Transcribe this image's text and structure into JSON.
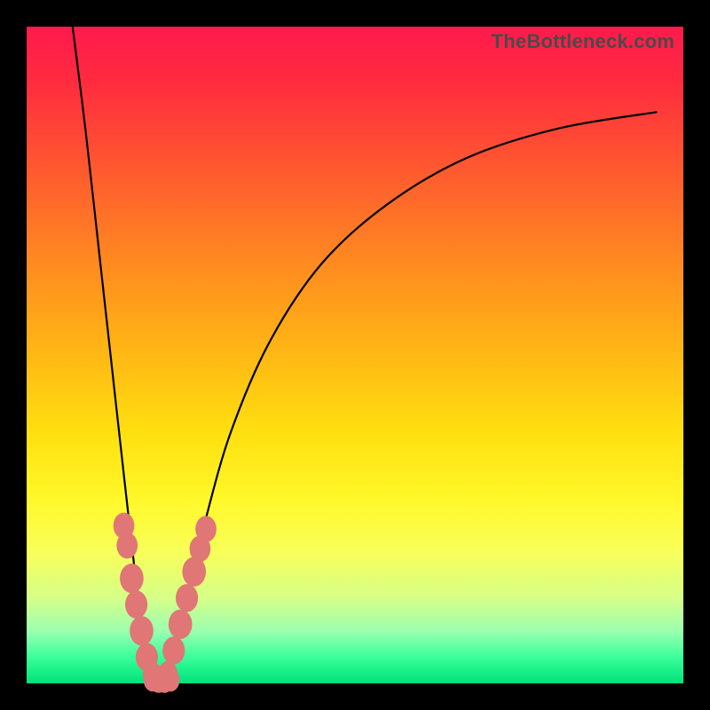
{
  "watermark": "TheBottleneck.com",
  "colors": {
    "frame": "#000000",
    "gradient_top": "#ff1a4d",
    "gradient_bottom": "#00e27a",
    "curve": "#000000",
    "bead": "#e07676"
  },
  "chart_data": {
    "type": "line",
    "title": "",
    "xlabel": "",
    "ylabel": "",
    "xlim": [
      0,
      100
    ],
    "ylim": [
      0,
      100
    ],
    "note": "No axis ticks or numeric labels are visible in the source image; x/y scales are nominal 0–100. y≈100 at top (red/bottleneck), y≈0 at bottom (green/balanced). The two branches form a V with minimum near x≈20.",
    "series": [
      {
        "name": "left-branch",
        "x": [
          7,
          9,
          11,
          13,
          15,
          17,
          18.5,
          19.5
        ],
        "y": [
          100,
          84,
          66,
          48,
          30,
          13,
          5,
          0
        ]
      },
      {
        "name": "right-branch",
        "x": [
          21,
          22,
          24,
          27,
          31,
          37,
          45,
          55,
          67,
          81,
          96
        ],
        "y": [
          0,
          4,
          12,
          24,
          38,
          52,
          64,
          73,
          80,
          84.5,
          87
        ]
      }
    ],
    "beads_left": [
      {
        "x": 14.8,
        "y": 24,
        "r": 1.6
      },
      {
        "x": 15.3,
        "y": 21,
        "r": 1.6
      },
      {
        "x": 16.0,
        "y": 16,
        "r": 1.8
      },
      {
        "x": 16.7,
        "y": 12,
        "r": 1.7
      },
      {
        "x": 17.5,
        "y": 8,
        "r": 1.8
      },
      {
        "x": 18.3,
        "y": 4,
        "r": 1.7
      },
      {
        "x": 19.2,
        "y": 1.3,
        "r": 1.5
      }
    ],
    "beads_right": [
      {
        "x": 21.5,
        "y": 1.5,
        "r": 1.5
      },
      {
        "x": 22.4,
        "y": 5,
        "r": 1.7
      },
      {
        "x": 23.4,
        "y": 9,
        "r": 1.8
      },
      {
        "x": 24.4,
        "y": 13,
        "r": 1.7
      },
      {
        "x": 25.5,
        "y": 17,
        "r": 1.8
      },
      {
        "x": 26.4,
        "y": 20.5,
        "r": 1.6
      },
      {
        "x": 27.3,
        "y": 23.5,
        "r": 1.6
      }
    ],
    "beads_bottom": [
      {
        "x": 19.2,
        "y": 0.5,
        "r": 1.4
      },
      {
        "x": 20.1,
        "y": 0.3,
        "r": 1.4
      },
      {
        "x": 21.0,
        "y": 0.3,
        "r": 1.4
      },
      {
        "x": 21.9,
        "y": 0.5,
        "r": 1.4
      }
    ]
  }
}
